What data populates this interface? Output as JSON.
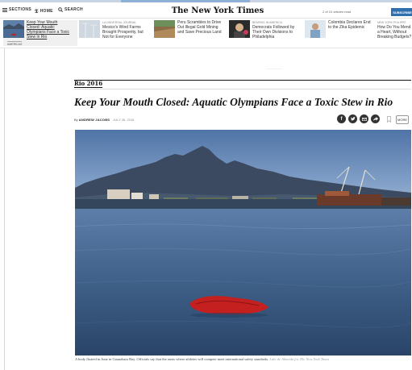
{
  "nav": {
    "sections_label": "SECTIONS",
    "home_label": "HOME",
    "search_label": "SEARCH",
    "logo": "The New York Times",
    "articles_remaining": "2 of 10 articles read",
    "subscribe_label": "SUBSCRIBE"
  },
  "stories": [
    {
      "kicker": "",
      "title": "Keep Your Mouth Closed: Aquatic Olympians Face a Toxic Stew in Rio",
      "badge": "AMERICAS"
    },
    {
      "kicker": "LA UNIVERSAL JOURNAL",
      "title": "Mexico's Wind Farms Brought Prosperity, but Not for Everyone"
    },
    {
      "kicker": "",
      "title": "Peru Scrambles to Drive Out Illegal Gold Mining and Save Precious Land"
    },
    {
      "kicker": "BEARING IN AMERICA",
      "title": "Democrats Followed by Their Own Divisions to Philadelphia"
    },
    {
      "kicker": "",
      "title": "Colombia Declares End to the Zika Epidemic"
    },
    {
      "kicker": "NEW YORK PHILIPPE",
      "title": "How Do You Mend a Heart, Without Breaking Budgets?"
    }
  ],
  "article": {
    "section": "Rio 2016",
    "headline": "Keep Your Mouth Closed: Aquatic Olympians Face a Toxic Stew in Rio",
    "byline_prefix": "By",
    "author": "ANDREW JACOBS",
    "date": "JULY 26, 2016",
    "more_label": "MORE",
    "caption": "A body floated in June in Guanabara Bay. Officials say that the areas where athletes will compete meet international safety standards.",
    "credit": "Lalo de Almeida for The New York Times"
  },
  "share_icons": [
    "facebook-icon",
    "twitter-icon",
    "email-icon",
    "share-icon",
    "bookmark-icon"
  ],
  "colors": {
    "subscribe": "#2f6fb0",
    "water": "#3d5d84",
    "sky": "#6d8fbc",
    "red_object": "#c42020"
  }
}
